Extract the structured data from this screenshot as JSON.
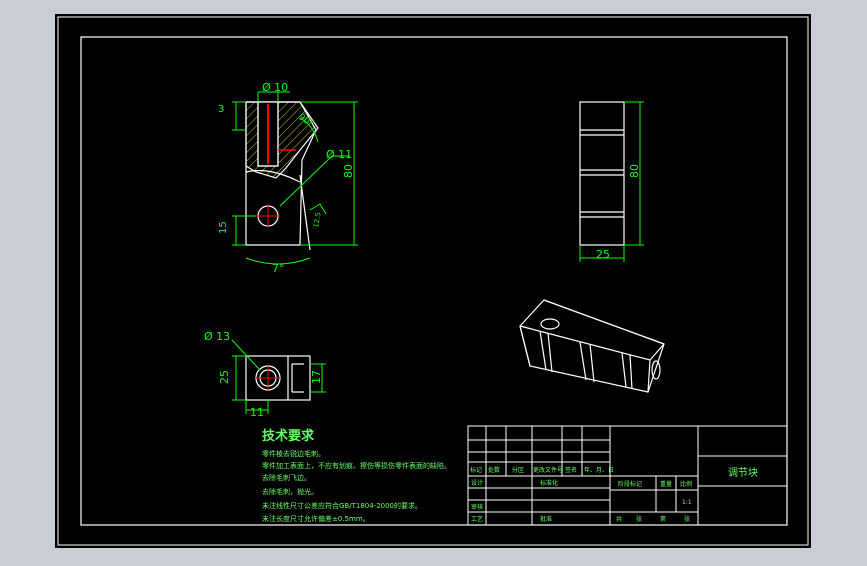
{
  "colors": {
    "background_outer": "#c9ced6",
    "canvas": "#000000",
    "line_white": "#ffffff",
    "dim_green": "#00ff00",
    "hatch_yellow": "#c8c800",
    "accent_red": "#ff0000",
    "text_green": "#66ff66"
  },
  "front_view": {
    "dia_top": "Ø 10",
    "angle_label": "90°",
    "dim_top_left": "3",
    "dia_hole": "Ø 11",
    "height": "80",
    "hole_height": "15",
    "bottom_angle": "7°",
    "roughness": "12.5"
  },
  "side_view": {
    "height": "80",
    "width": "25"
  },
  "bottom_view": {
    "dia": "Ø 13",
    "height": "25",
    "offset": "11",
    "slot": "17"
  },
  "notes": {
    "title": "技术要求",
    "lines": [
      "零件棱去锐边毛刺。",
      "零件加工表面上，不应有划痕、擦伤等损伤零件表面的缺陷。",
      "去除毛刺飞边。",
      "去除毛刺，抛光。",
      "未注线性尺寸公差应符合GB/T1804-2000的要求。",
      "未注长度尺寸允许偏差±0.5mm。"
    ]
  },
  "title_block": {
    "part_name": "调节块",
    "row_headers": [
      "标记",
      "处数",
      "分区",
      "更改文件号",
      "签名",
      "年、月、日"
    ],
    "left_labels": [
      "设计",
      "审核",
      "工艺"
    ],
    "std_label": "标准化",
    "approve_label": "批准",
    "stage_label": "阶段标记",
    "weight_label": "重量",
    "scale_label": "比例",
    "scale_value": "1:1",
    "sheet_labels": [
      "共",
      "张",
      "第",
      "张"
    ]
  }
}
